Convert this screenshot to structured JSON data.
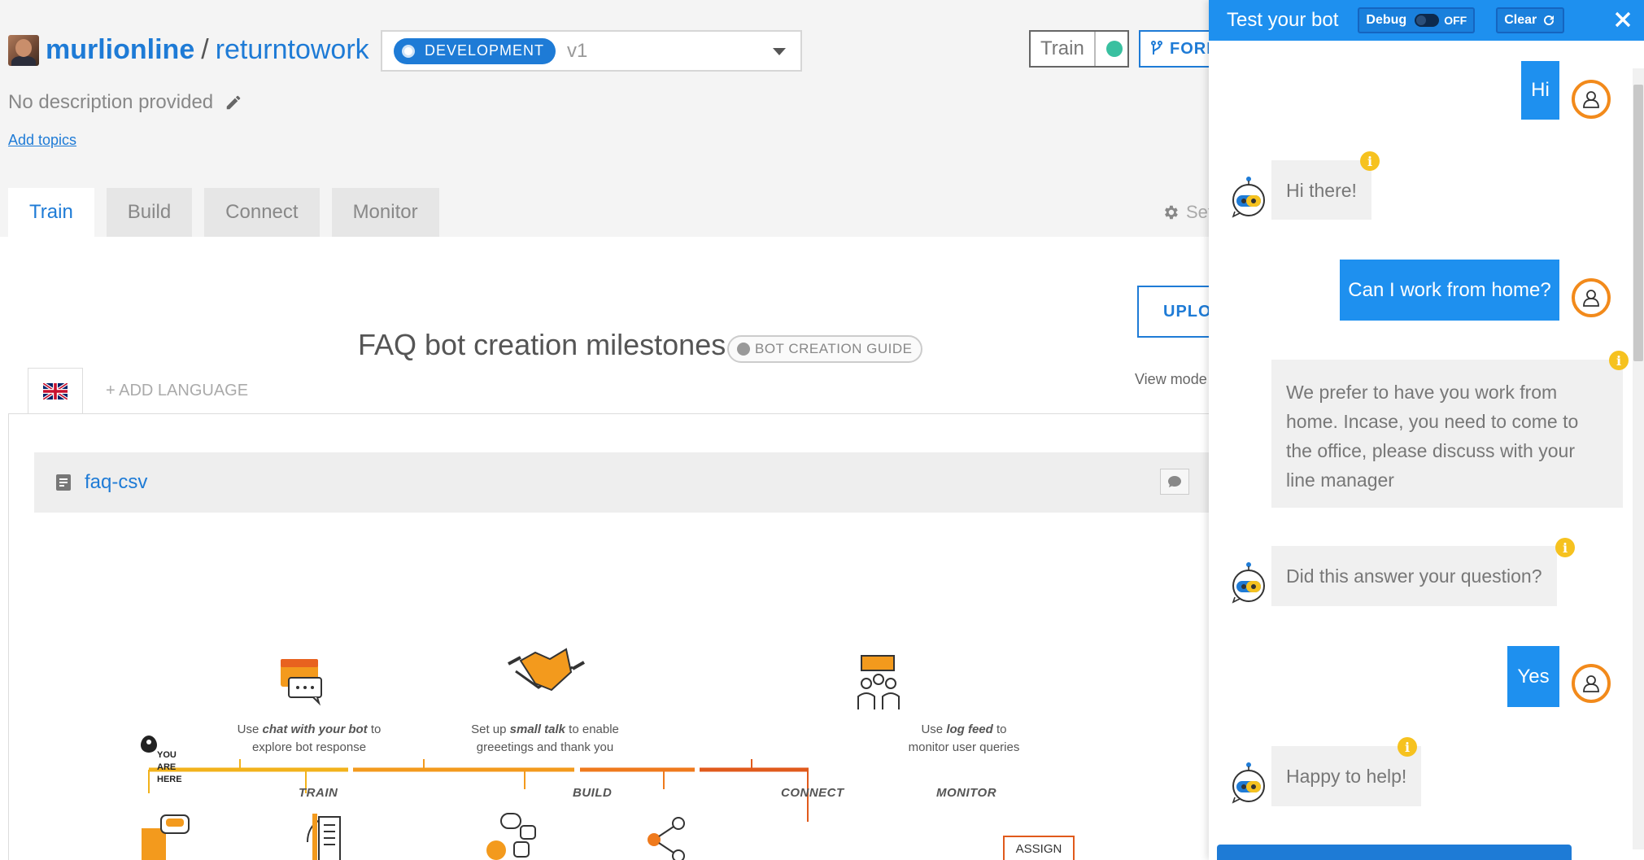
{
  "header": {
    "owner": "murlionline",
    "separator": "/",
    "bot": "returntowork",
    "env_label": "DEVELOPMENT",
    "version": "v1",
    "train_label": "Train",
    "fork_label": "FORK",
    "description": "No description provided",
    "add_topics": "Add topics"
  },
  "tabs": [
    {
      "label": "Train",
      "active": true
    },
    {
      "label": "Build"
    },
    {
      "label": "Connect"
    },
    {
      "label": "Monitor"
    }
  ],
  "settings_label": "Settings",
  "content": {
    "upload_label": "UPLOAD",
    "add_language": "+ ADD LANGUAGE",
    "view_mode": "View mode",
    "faq_name": "faq-csv",
    "milestones_title": "FAQ bot creation milestones",
    "guide_label": "BOT CREATION GUIDE",
    "you_are_here": [
      "YOU",
      "ARE",
      "HERE"
    ],
    "phases": [
      "TRAIN",
      "BUILD",
      "CONNECT",
      "MONITOR"
    ],
    "milestone_texts": {
      "train": {
        "pre": "Use ",
        "em": "chat with your bot",
        "post": " to",
        "line2": "explore bot response"
      },
      "build": {
        "pre": "Set up ",
        "em": "small talk",
        "post": " to enable",
        "line2": "greeetings and thank you"
      },
      "monitor": {
        "pre": "Use ",
        "em": "log feed",
        "post": " to",
        "line2": "monitor user queries"
      }
    },
    "assign_label": "ASSIGN"
  },
  "chat": {
    "title": "Test your bot",
    "debug_label": "Debug",
    "debug_state": "OFF",
    "clear_label": "Clear",
    "messages": [
      {
        "from": "user",
        "text": "Hi"
      },
      {
        "from": "bot",
        "text": "Hi there!"
      },
      {
        "from": "user",
        "text": "Can I work from home?"
      },
      {
        "from": "bot",
        "lines": [
          "We prefer to have you work from",
          "home. Incase, you need to come to",
          "the office, please discuss with your",
          "line manager"
        ]
      },
      {
        "from": "bot",
        "text": "Did this answer your question?"
      },
      {
        "from": "user",
        "text": "Yes"
      },
      {
        "from": "bot",
        "text": "Happy to help!"
      }
    ],
    "colors": {
      "accent": "#1e90ef",
      "avatar_ring": "#f28a1b",
      "info": "#f6c21f"
    }
  }
}
